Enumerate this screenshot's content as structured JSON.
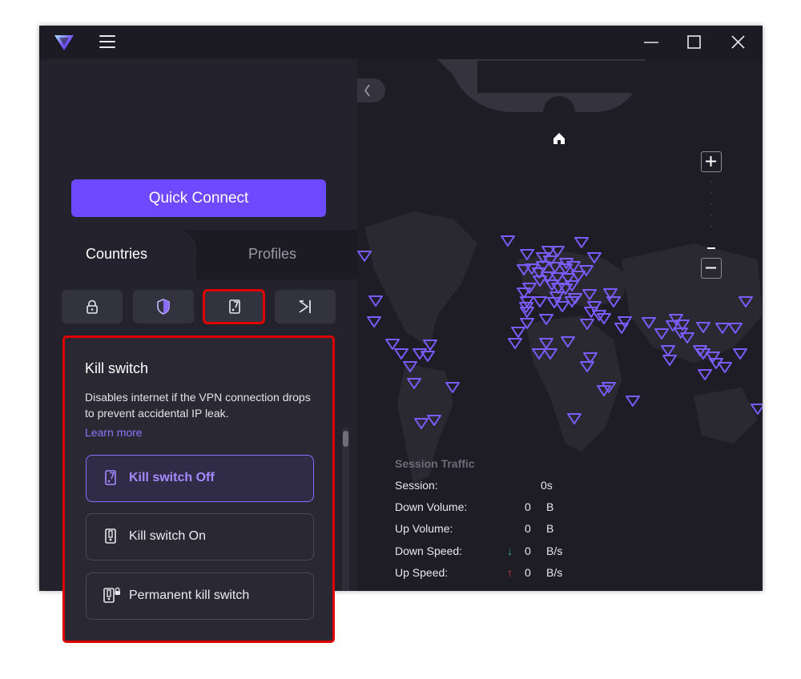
{
  "sidebar": {
    "quick_connect_label": "Quick Connect",
    "tabs": [
      {
        "label": "Countries",
        "active": true
      },
      {
        "label": "Profiles",
        "active": false
      }
    ],
    "feature_buttons": [
      {
        "name": "secure-core",
        "icon": "lock-icon"
      },
      {
        "name": "netshield",
        "icon": "shield-icon"
      },
      {
        "name": "kill-switch",
        "icon": "kill-switch-icon",
        "active": true
      },
      {
        "name": "split-tunneling",
        "icon": "arrow-to-bar-icon"
      }
    ]
  },
  "popover": {
    "title": "Kill switch",
    "description": "Disables internet if the VPN connection drops to prevent accidental IP leak.",
    "learn_more": "Learn more",
    "options": [
      {
        "label": "Kill switch Off",
        "selected": true
      },
      {
        "label": "Kill switch On",
        "selected": false
      },
      {
        "label": "Permanent kill switch",
        "selected": false
      }
    ]
  },
  "map": {
    "session_traffic_title": "Session Traffic",
    "rows": [
      {
        "label": "Session:",
        "value": "0s",
        "unit": ""
      },
      {
        "label": "Down Volume:",
        "value": "0",
        "unit": "B"
      },
      {
        "label": "Up Volume:",
        "value": "0",
        "unit": "B"
      },
      {
        "label": "Down Speed:",
        "value": "0",
        "unit": "B/s",
        "arrow": "↓"
      },
      {
        "label": "Up Speed:",
        "value": "0",
        "unit": "B/s",
        "arrow": "↑"
      }
    ]
  },
  "colors": {
    "accent": "#6d4aff",
    "highlight_border": "#e00000",
    "down_arrow": "#2fb39a",
    "up_arrow": "#e0304e"
  }
}
